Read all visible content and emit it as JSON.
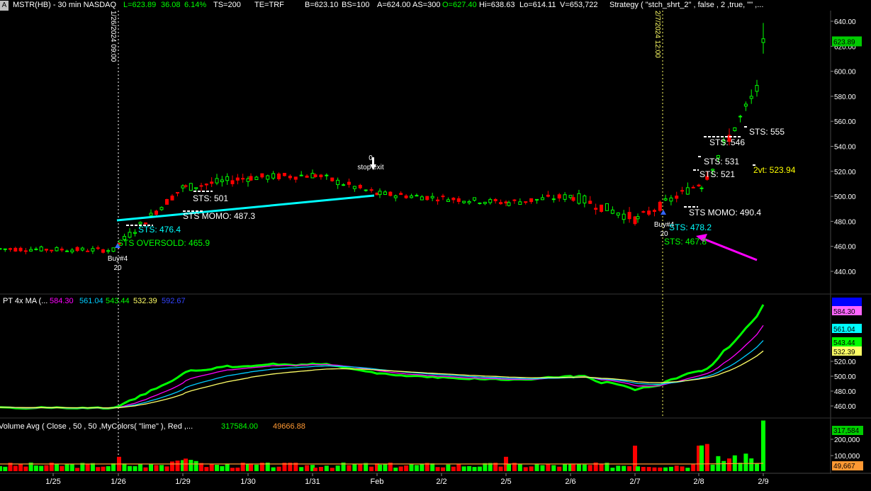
{
  "header": {
    "corner_icon": "A",
    "symbol": "MSTR(HB) - 30 min  NASDAQ",
    "last": "L=623.89",
    "change": "36.08",
    "change_pct": "6.14%",
    "ts": "TS=200",
    "te": "TE=TRF",
    "bid": "B=623.10",
    "bid_size": "BS=100",
    "ask": "A=624.00",
    "ask_size": "AS=300",
    "open": "O=627.40",
    "high": "Hi=638.63",
    "low": "Lo=614.11",
    "volume": "V=653,722",
    "strategy": "Strategy ( \"stch_shrt_2\" , false , 2 ,true, \"\" ,..."
  },
  "colors": {
    "bg": "#000000",
    "up": "#00ff00",
    "down": "#ff0000",
    "cyan": "#00ffff",
    "magenta": "#ff00ff",
    "yellow": "#ffff00",
    "green": "#00ff00",
    "blue": "#0000ff",
    "ma1": "#ff00ff",
    "ma2": "#00ccff",
    "ma3": "#00ff00",
    "ma4": "#ffff66"
  },
  "chart_data": [
    {
      "type": "candlestick",
      "title": "MSTR(HB) - 30 min NASDAQ",
      "ylim": [
        425,
        645
      ],
      "y_ticks": [
        "640.00",
        "620.00",
        "600.00",
        "580.00",
        "560.00",
        "540.00",
        "520.00",
        "500.00",
        "480.00",
        "460.00",
        "440.00"
      ],
      "last_price_label": "623.89",
      "x_ticks": [
        "1/25",
        "1/26",
        "1/29",
        "1/30",
        "1/31",
        "Feb",
        "2/2",
        "2/5",
        "2/6",
        "2/7",
        "2/8",
        "2/9"
      ],
      "segments": [
        {
          "from": "1/25",
          "to": "1/26 open",
          "start": 458,
          "end": 457,
          "noise": 4
        },
        {
          "from": "1/26 09:00",
          "to": "1/29",
          "start": 462,
          "end": 507,
          "noise": 6
        },
        {
          "from": "1/29",
          "to": "1/30",
          "start": 507,
          "end": 515,
          "noise": 7
        },
        {
          "from": "1/30",
          "to": "1/31",
          "start": 515,
          "end": 517,
          "noise": 6
        },
        {
          "from": "1/31",
          "to": "Feb",
          "start": 517,
          "end": 502,
          "noise": 6
        },
        {
          "from": "Feb",
          "to": "2/5",
          "start": 502,
          "end": 495,
          "noise": 5
        },
        {
          "from": "2/5",
          "to": "2/6",
          "start": 495,
          "end": 500,
          "noise": 6
        },
        {
          "from": "2/6",
          "to": "2/7",
          "start": 500,
          "end": 482,
          "noise": 8
        },
        {
          "from": "2/7",
          "to": "2/8",
          "start": 482,
          "end": 510,
          "noise": 7
        },
        {
          "from": "2/8",
          "to": "2/9",
          "start": 510,
          "end": 585,
          "noise": 10
        },
        {
          "from": "2/9",
          "to": "last",
          "start": 585,
          "end": 623.89,
          "noise": 6
        }
      ],
      "vertical_markers": [
        {
          "label": "1/26/2024 09:00",
          "color": "#ffffff"
        },
        {
          "label": "2/7/2024 12:00",
          "color": "#ffff66"
        }
      ],
      "annotations": [
        {
          "text": "STS: 501",
          "color": "#ffffff"
        },
        {
          "text": "STS MOMO: 487.3",
          "color": "#ffffff"
        },
        {
          "text": "STS: 476.4",
          "color": "#00ffff"
        },
        {
          "text": "STS OVERSOLD: 465.9",
          "color": "#00ff00"
        },
        {
          "text": "Buy#4",
          "color": "#ffffff"
        },
        {
          "text": "20",
          "color": "#ffffff"
        },
        {
          "text": "0",
          "color": "#ffffff"
        },
        {
          "text": "stop exit",
          "color": "#ffffff"
        },
        {
          "text": "STS: 555",
          "color": "#ffffff"
        },
        {
          "text": "STS: 546",
          "color": "#ffffff"
        },
        {
          "text": "STS: 531",
          "color": "#ffffff"
        },
        {
          "text": "STS: 521",
          "color": "#ffffff"
        },
        {
          "text": "2vt: 523.94",
          "color": "#ffff00"
        },
        {
          "text": "STS MOMO: 490.4",
          "color": "#ffffff"
        },
        {
          "text": "Buy#4",
          "color": "#ffffff"
        },
        {
          "text": "20",
          "color": "#ffffff"
        },
        {
          "text": "STS: 478.2",
          "color": "#00ffff"
        },
        {
          "text": "STS: 467.8",
          "color": "#00ff00"
        }
      ]
    },
    {
      "type": "line",
      "title": "PT 4x MA (...",
      "ylim": [
        452,
        595
      ],
      "y_ticks": [
        "520.00",
        "500.00",
        "480.00",
        "460.00"
      ],
      "series": [
        {
          "name": "584.30",
          "color": "#ff00ff",
          "end": 584.3
        },
        {
          "name": "561.04",
          "color": "#00ccff",
          "end": 561.04
        },
        {
          "name": "543.44",
          "color": "#00ff00",
          "end": 543.44
        },
        {
          "name": "532.39",
          "color": "#ffff66",
          "end": 532.39
        },
        {
          "name": "592.67",
          "color": "#0000ff",
          "end": 592.67
        }
      ],
      "value_labels": [
        "584.30",
        "561.04",
        "543.44",
        "532.39"
      ]
    },
    {
      "type": "bar",
      "title": "Volume Avg ( Close , 50 , 50 ,MyColors( \"lime\" ), Red ,...",
      "series_labels": [
        "317584.00",
        "49666.88"
      ],
      "y_ticks": [
        "200,000",
        "100,000"
      ],
      "value_labels": [
        "317,584",
        "49,667"
      ],
      "ylim": [
        0,
        330000
      ]
    }
  ]
}
